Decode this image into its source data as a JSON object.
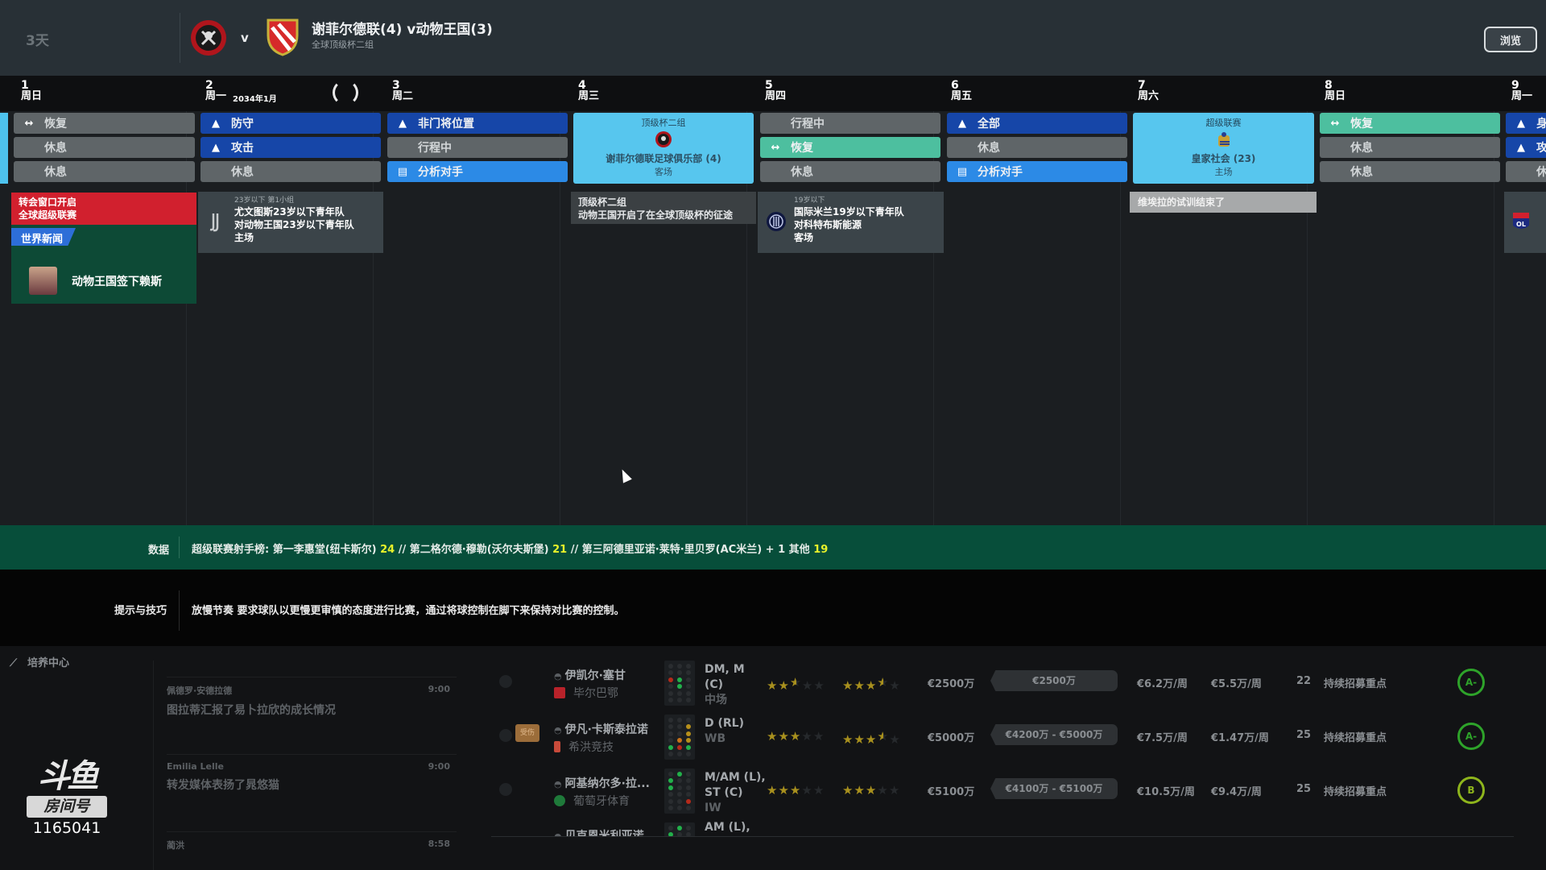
{
  "topbar": {
    "days_left": "3天",
    "vs": "v",
    "match_title": "谢菲尔德联(4) v动物王国(3)",
    "match_subtitle": "全球顶级杯二组",
    "browse_label": "浏览",
    "home_crest": "sheffield-united-crest",
    "away_crest": "energie-cottbus-crest"
  },
  "calendar": {
    "month_label": "2034年1月",
    "days": [
      {
        "num": "1",
        "weekday": "周日"
      },
      {
        "num": "2",
        "weekday": "周一"
      },
      {
        "num": "3",
        "weekday": "周二"
      },
      {
        "num": "4",
        "weekday": "周三"
      },
      {
        "num": "5",
        "weekday": "周四"
      },
      {
        "num": "6",
        "weekday": "周五"
      },
      {
        "num": "7",
        "weekday": "周六"
      },
      {
        "num": "8",
        "weekday": "周日"
      },
      {
        "num": "9",
        "weekday": "周一"
      }
    ],
    "sessions": {
      "d1": [
        "恢复",
        "休息",
        "休息"
      ],
      "d2": [
        "防守",
        "攻击",
        "休息"
      ],
      "d3": [
        "非门将位置",
        "行程中",
        "分析对手"
      ],
      "d5": [
        "行程中",
        "恢复",
        "休息"
      ],
      "d6": [
        "全部",
        "休息",
        "分析对手"
      ],
      "d8": [
        "恢复",
        "休息",
        "休息"
      ],
      "d9": [
        "身",
        "攻",
        "休"
      ]
    },
    "matches": {
      "d4": {
        "competition": "顶级杯二组",
        "opponent": "谢菲尔德联足球俱乐部 (4)",
        "venue": "客场"
      },
      "d7": {
        "competition": "超级联赛",
        "opponent": "皇家社会 (23)",
        "venue": "主场"
      }
    },
    "events": {
      "transfer_window": {
        "title": "转会窗口开启",
        "sub": "全球超级联赛"
      },
      "world_news": {
        "tag": "世界新闻",
        "headline": "动物王国签下赖斯"
      },
      "u23_fixture": {
        "category": "23岁以下 第1小组",
        "line1": "尤文图斯23岁以下青年队",
        "line2": "对动物王国23岁以下青年队",
        "venue": "主场"
      },
      "cup_start": {
        "title": "顶级杯二组",
        "sub": "动物王国开启了在全球顶级杯的征途"
      },
      "u19_fixture": {
        "category": "19岁以下",
        "line1": "国际米兰19岁以下青年队",
        "line2": "对科特布斯能源",
        "venue": "客场"
      },
      "trial_end": {
        "title": "维埃拉的试训结束了"
      }
    }
  },
  "ticker": {
    "label": "数据",
    "prefix": "超级联赛射手榜: 第一李惠堂(纽卡斯尔) ",
    "v1": "24",
    "mid1": " // 第二格尔德·穆勒(沃尔夫斯堡) ",
    "v2": "21",
    "mid2": " // 第三阿德里亚诺·莱特·里贝罗(AC米兰) + 1 其他 ",
    "v3": "19"
  },
  "tips": {
    "label": "提示与技巧",
    "text": "放慢节奏 要求球队以更慢更审慎的态度进行比赛，通过将球控制在脚下来保持对比赛的控制。"
  },
  "bottom": {
    "section_title": "培养中心",
    "messages": [
      {
        "from": "佩德罗·安德拉德",
        "time": "9:00",
        "subject": "图拉蒂汇报了易卜拉欣的成长情况"
      },
      {
        "from": "Emilia Lelle",
        "time": "9:00",
        "subject": "转发媒体表扬了晁悠猫"
      },
      {
        "from": "蔺洪",
        "time": "8:58",
        "subject": ""
      }
    ],
    "watermark": {
      "logo": "斗鱼",
      "room_label": "房间号",
      "room_number": "1165041"
    }
  },
  "shortlist": [
    {
      "name": "伊凯尔·塞甘",
      "club": "毕尔巴鄂",
      "positions": "DM, M",
      "positions2": "(C)",
      "role": "中场",
      "ability_stars": 2.5,
      "potential_stars": 3.5,
      "value": "€2500万",
      "asking": "€2500万",
      "wage": "€6.2万/周",
      "wage2": "€5.5万/周",
      "age": "22",
      "status": "持续招募重点",
      "grade": "A-",
      "injured": false
    },
    {
      "name": "伊凡·卡斯泰拉诺",
      "club": "希洪竞技",
      "positions": "D (RL)",
      "positions2": "",
      "role": "WB",
      "ability_stars": 3,
      "potential_stars": 3.5,
      "value": "€5000万",
      "asking": "€4200万 - €5000万",
      "wage": "€7.5万/周",
      "wage2": "€1.47万/周",
      "age": "25",
      "status": "持续招募重点",
      "grade": "A-",
      "injured": true,
      "injury_label": "受伤"
    },
    {
      "name": "阿基纳尔多·拉...",
      "club": "葡萄牙体育",
      "positions": "M/AM (L),",
      "positions2": "ST (C)",
      "role": "IW",
      "ability_stars": 3,
      "potential_stars": 3,
      "value": "€5100万",
      "asking": "€4100万 - €5100万",
      "wage": "€10.5万/周",
      "wage2": "€9.4万/周",
      "age": "25",
      "status": "持续招募重点",
      "grade": "B",
      "injured": false
    },
    {
      "name": "贝克恩米利亚诺",
      "club": "",
      "positions": "AM (L),",
      "positions2": "",
      "role": "",
      "ability_stars": 0,
      "potential_stars": 0,
      "value": "",
      "asking": "",
      "wage": "",
      "wage2": "",
      "age": "",
      "status": "",
      "grade": "",
      "injured": false
    }
  ]
}
